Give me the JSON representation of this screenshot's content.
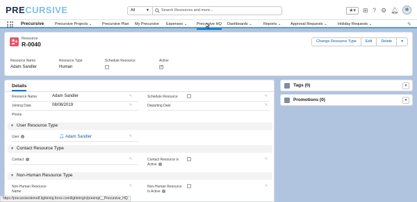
{
  "app": {
    "logo_main": "PRE",
    "logo_accent": "CURSIVE",
    "name": "Precursive"
  },
  "search": {
    "scope": "All",
    "placeholder": "Search Resources and more..."
  },
  "nav": {
    "items": [
      {
        "label": "Precursive Projects",
        "chev": "⌄"
      },
      {
        "label": "Precursive Plan",
        "chev": ""
      },
      {
        "label": "My Precursive",
        "chev": ""
      },
      {
        "label": "Expenses",
        "chev": "⌄"
      },
      {
        "label": "Precursive HQ",
        "chev": ""
      },
      {
        "label": "Dashboards",
        "chev": "⌄"
      },
      {
        "label": "Reports",
        "chev": "⌄"
      },
      {
        "label": "Approval Requests",
        "chev": "⌄"
      },
      {
        "label": "Holiday Requests",
        "chev": "⌄"
      }
    ],
    "active_index": 4
  },
  "record": {
    "type": "Resource",
    "title": "R-0040",
    "actions": [
      "Change Resource Type",
      "Edit",
      "Delete"
    ],
    "fields": [
      {
        "label": "Resource Name",
        "value": "Adam Sandler"
      },
      {
        "label": "Resource Type",
        "value": "Human"
      },
      {
        "label": "Schedule Resource",
        "checked": false
      },
      {
        "label": "Active",
        "checked": true
      }
    ]
  },
  "details": {
    "tab": "Details",
    "left_fields": [
      {
        "label": "Resource Name",
        "value": "Adam Sandler"
      },
      {
        "label": "Joining Date",
        "value": "08/08/2019"
      },
      {
        "label": "Phone",
        "value": ""
      }
    ],
    "right_fields": [
      {
        "label": "Schedule Resource",
        "checked": false
      },
      {
        "label": "Departing Date",
        "value": ""
      }
    ],
    "sections": [
      {
        "title": "User Resource Type"
      },
      {
        "title": "Contact Resource Type"
      },
      {
        "title": "Non-Human Resource Type"
      }
    ],
    "user_field": {
      "label": "User",
      "value": "Adam Sandler"
    },
    "contact_field": {
      "label": "Contact"
    },
    "contact_active": {
      "label_line1": "Contact Resource is",
      "label_line2": "Active",
      "checked": false
    },
    "nonhuman_name": {
      "label_line1": "Non-Human Resource",
      "label_line2": "Name"
    },
    "nonhuman_active": {
      "label_line1": "Non-Human Resource",
      "label_line2": "Is Active",
      "checked": false
    }
  },
  "sidebar_cards": [
    {
      "title": "Tags (0)"
    },
    {
      "title": "Promotions (0)"
    }
  ],
  "status_url": "https://precursivedemo8.lightning.force.com/lightning/n/preempl__Precursive_HQ",
  "colors": {
    "brand_dark": "#1d2a52",
    "brand_accent": "#7cc1e9",
    "record_icon": "#e3566a",
    "link": "#0b5cab",
    "background": "#b0c4df"
  }
}
